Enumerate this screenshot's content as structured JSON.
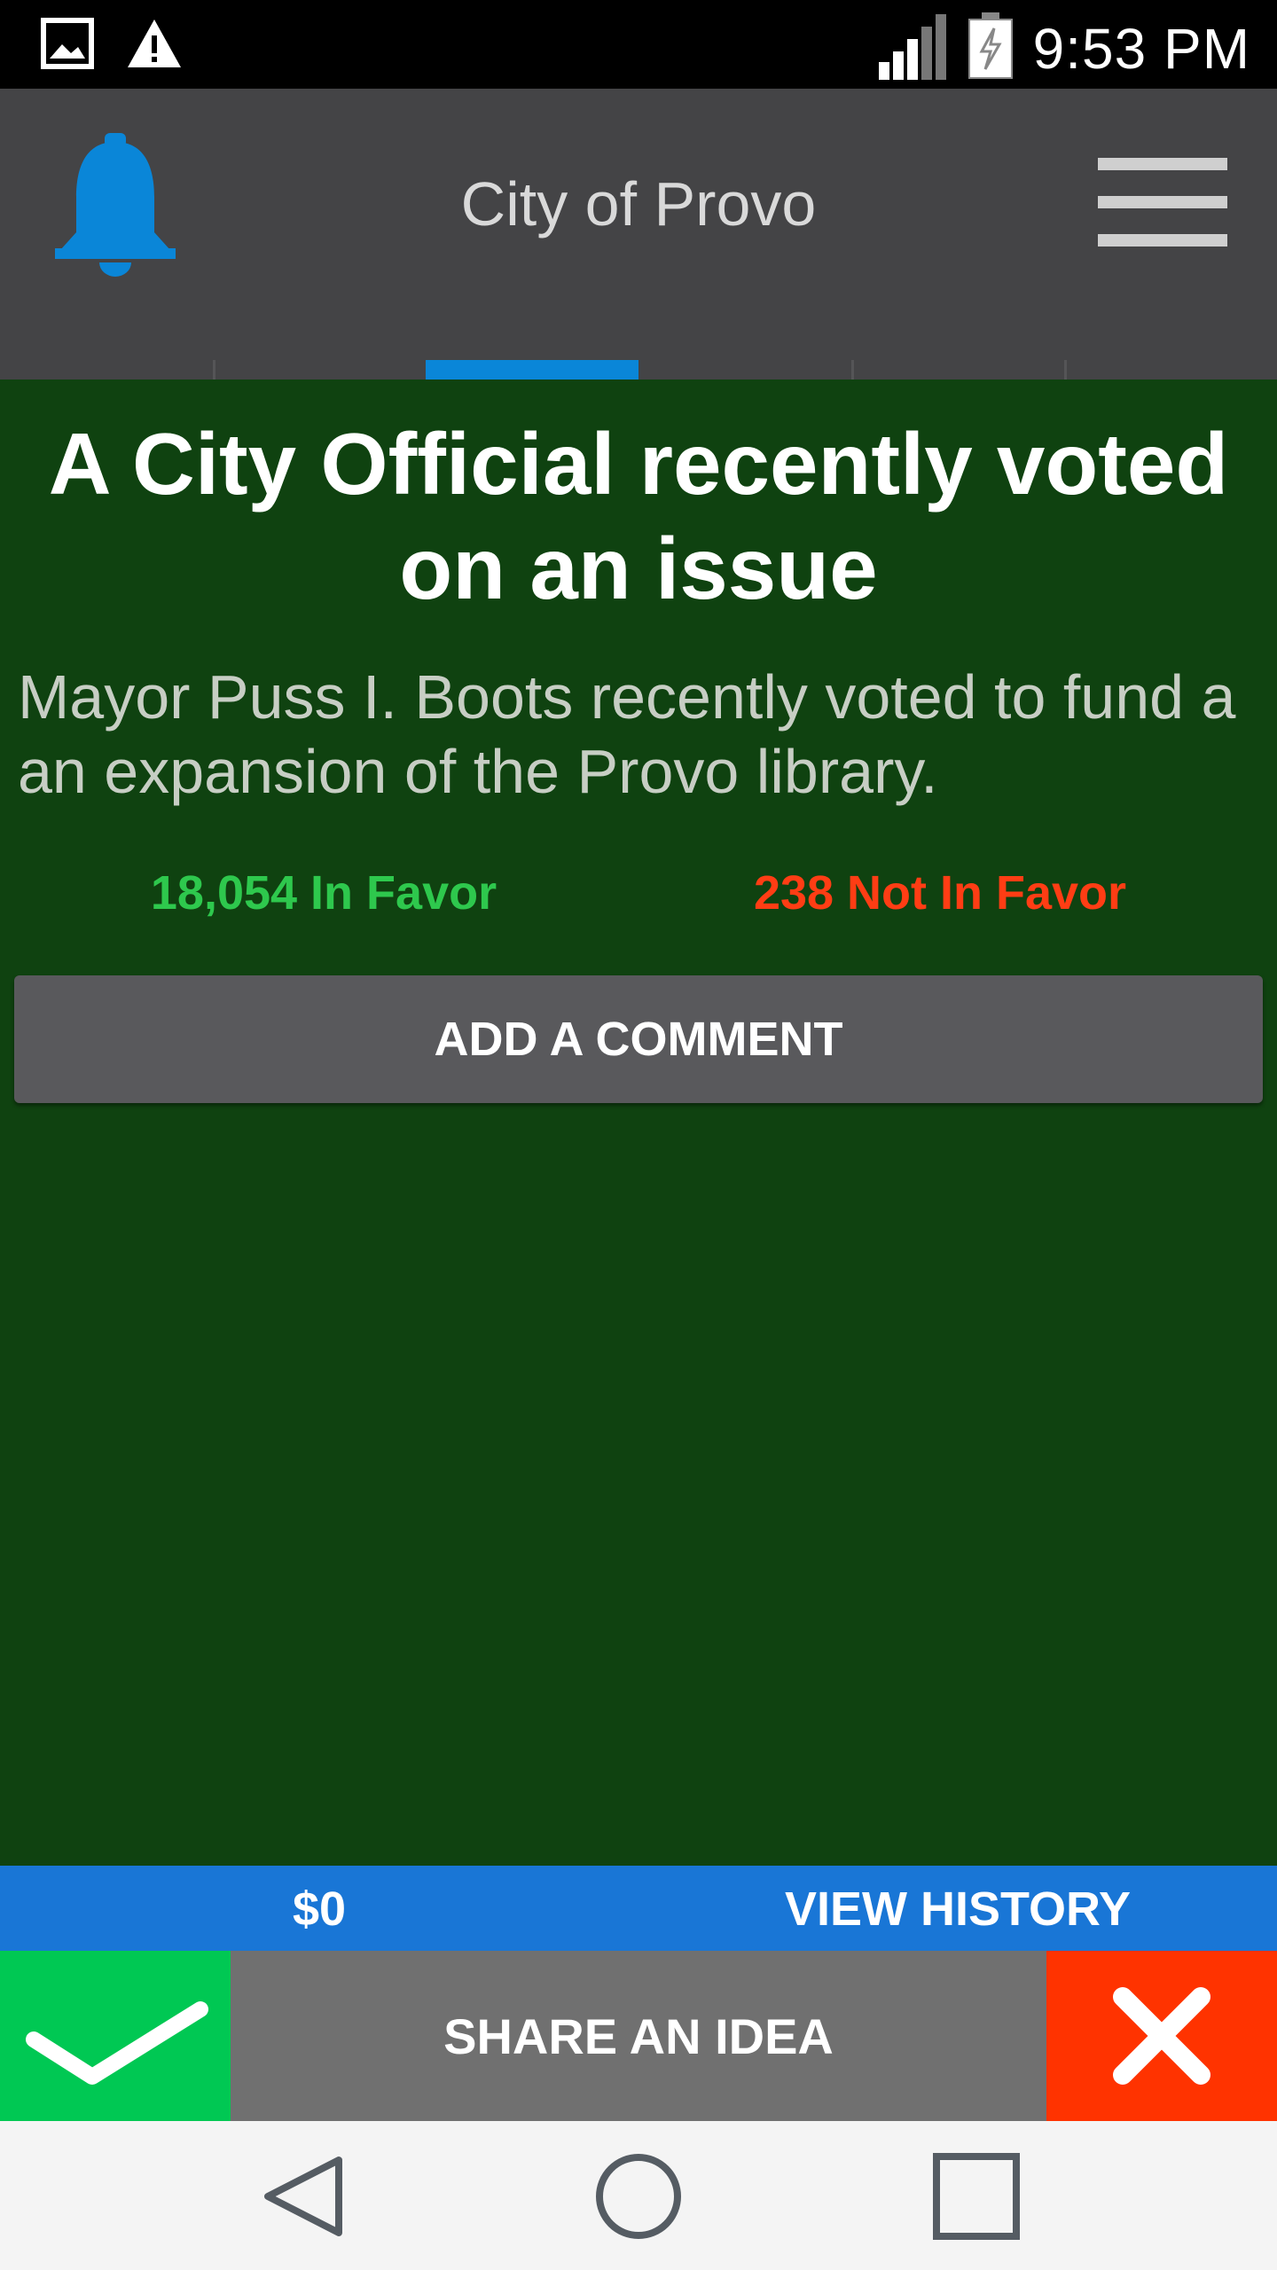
{
  "status_bar": {
    "time": "9:53 PM",
    "left_icons": [
      "image-icon",
      "warning-icon"
    ],
    "right_icons": [
      "signal-icon",
      "battery-charging-icon"
    ]
  },
  "header": {
    "title": "City of Provo",
    "left_icon": "bell-icon",
    "right_icon": "menu-icon",
    "accent_color": "#0a86d8"
  },
  "content": {
    "headline": "A City Official recently voted on an issue",
    "description": "Mayor Puss I. Boots recently voted to fund a an expansion of the Provo library.",
    "in_favor": "18,054 In Favor",
    "not_in_favor": "238 Not In Favor",
    "comment_button": "ADD A COMMENT",
    "background_color": "#0f4210"
  },
  "bottom_bar": {
    "balance": "$0",
    "history_label": "VIEW HISTORY",
    "share_label": "SHARE AN IDEA",
    "approve_icon": "check-icon",
    "reject_icon": "close-icon"
  },
  "nav_bar": {
    "items": [
      "back-icon",
      "home-icon",
      "recents-icon"
    ]
  }
}
